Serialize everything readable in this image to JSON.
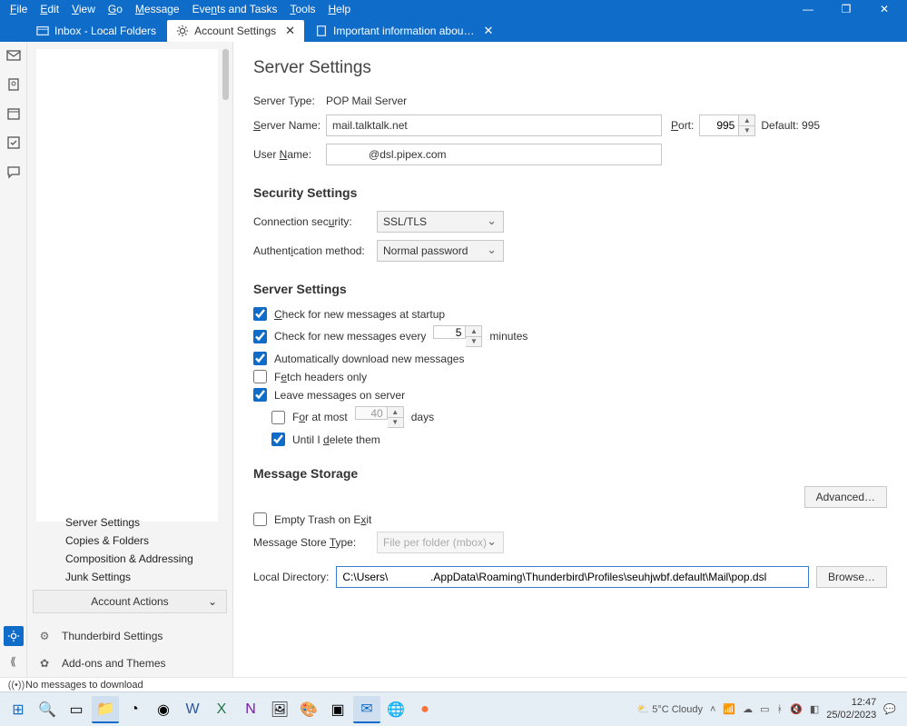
{
  "menu": [
    "File",
    "Edit",
    "View",
    "Go",
    "Message",
    "Events and Tasks",
    "Tools",
    "Help"
  ],
  "window_buttons": {
    "min": "—",
    "max": "❐",
    "close": "✕"
  },
  "tabs": [
    {
      "label": "Inbox - Local Folders",
      "active": false,
      "closable": false
    },
    {
      "label": "Account Settings",
      "active": true,
      "closable": true
    },
    {
      "label": "Important information abou…",
      "active": false,
      "closable": true
    }
  ],
  "sidebar": {
    "items": [
      "Server Settings",
      "Copies & Folders",
      "Composition & Addressing",
      "Junk Settings"
    ],
    "account_actions": "Account Actions",
    "thunderbird_settings": "Thunderbird Settings",
    "addons": "Add-ons and Themes"
  },
  "page": {
    "title": "Server Settings",
    "server_type_label": "Server Type:",
    "server_type": "POP Mail Server",
    "server_name_label": "Server Name:",
    "server_name": "mail.talktalk.net",
    "port_label": "Port:",
    "port": "995",
    "default_port": "Default: 995",
    "user_name_label": "User Name:",
    "user_name": "            @dsl.pipex.com",
    "sec_heading": "Security Settings",
    "conn_sec_label": "Connection security:",
    "conn_sec": "SSL/TLS",
    "auth_label": "Authentication method:",
    "auth": "Normal password",
    "srv_heading": "Server Settings",
    "chk_startup": "Check for new messages at startup",
    "chk_every_pre": "Check for new messages every",
    "chk_every_val": "5",
    "chk_every_post": "minutes",
    "chk_auto": "Automatically download new messages",
    "chk_fetch": "Fetch headers only",
    "chk_leave": "Leave messages on server",
    "chk_atmost_pre": "For at most",
    "chk_atmost_val": "40",
    "chk_atmost_post": "days",
    "chk_until": "Until I delete them",
    "msg_heading": "Message Storage",
    "chk_empty": "Empty Trash on Exit",
    "advanced": "Advanced…",
    "store_label": "Message Store Type:",
    "store": "File per folder (mbox)",
    "localdir_label": "Local Directory:",
    "localdir": "C:\\Users\\              .AppData\\Roaming\\Thunderbird\\Profiles\\seuhjwbf.default\\Mail\\pop.dsl",
    "browse": "Browse…"
  },
  "statusbar": "No messages to download",
  "tray": {
    "weather": "5°C  Cloudy",
    "time": "12:47",
    "date": "25/02/2023"
  }
}
